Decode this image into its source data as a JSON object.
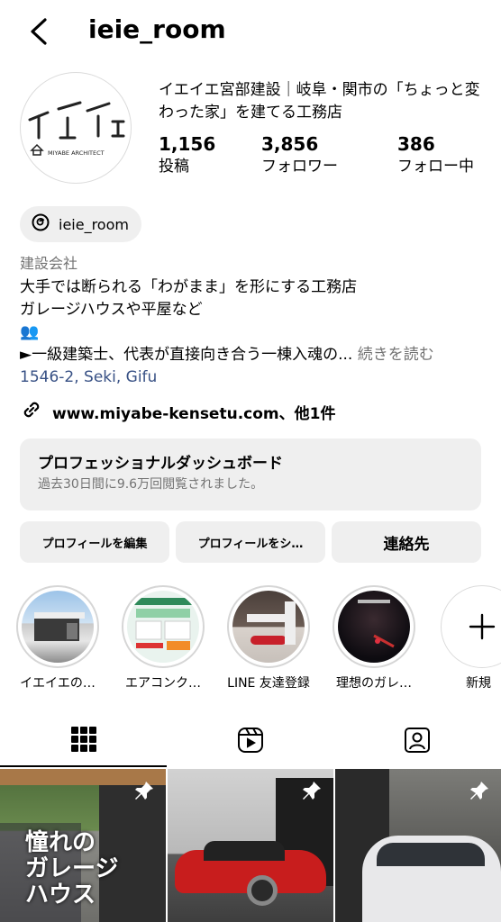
{
  "header": {
    "username": "ieie_room"
  },
  "profile": {
    "name": "イエイエ宮部建設｜岐阜・関市の「ちょっと変わった家」を建てる工務店",
    "logo_subtext": "MIYABE ARCHITECT",
    "stats": [
      {
        "value": "1,156",
        "label": "投稿"
      },
      {
        "value": "3,856",
        "label": "フォロワー"
      },
      {
        "value": "386",
        "label": "フォロー中"
      }
    ],
    "threads_handle": "ieie_room",
    "category": "建設会社",
    "bio": [
      "大手では断られる「わがまま」を形にする工務店",
      "ガレージハウスや平屋など",
      "👥",
      "►一級建築士、代表が直接向き合う一棟入魂の..."
    ],
    "more_label": "続きを読む",
    "location": "1546-2, Seki, Gifu",
    "link": "www.miyabe-kensetu.com、他1件"
  },
  "dashboard": {
    "title": "プロフェッショナルダッシュボード",
    "subtitle": "過去30日間に9.6万回閲覧されました。"
  },
  "buttons": {
    "edit": "プロフィールを編集",
    "share": "プロフィールをシ…",
    "contact": "連絡先"
  },
  "highlights": [
    {
      "label": "イエイエの…"
    },
    {
      "label": "エアコンク…"
    },
    {
      "label": "LINE 友達登録"
    },
    {
      "label": "理想のガレ…"
    },
    {
      "label": "新規"
    }
  ],
  "post1": {
    "title_line1": "憧れの",
    "title_line2": "ガレージ",
    "title_line3": "ハウス"
  },
  "icons": [
    "chevron-left-icon",
    "threads-icon",
    "link-icon",
    "plus-icon",
    "grid-icon",
    "reels-icon",
    "tagged-icon",
    "pin-icon"
  ]
}
